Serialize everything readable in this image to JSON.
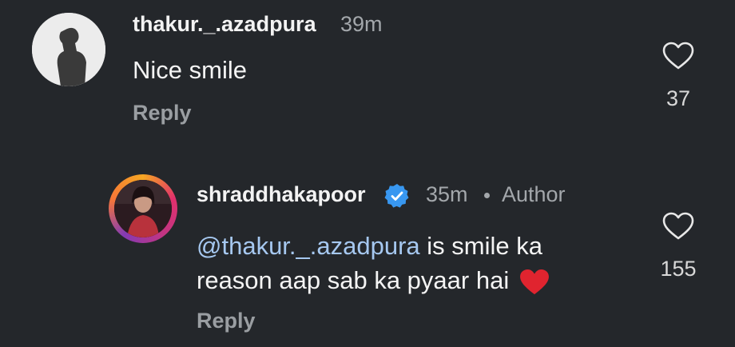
{
  "comments": [
    {
      "username": "thakur._.azadpura",
      "time": "39m",
      "text": "Nice smile",
      "reply_label": "Reply",
      "like_count": "37",
      "avatar_icon": "user-avatar-icon"
    },
    {
      "username": "shraddhakapoor",
      "time": "35m",
      "author_label": "Author",
      "mention": "@thakur._.azadpura",
      "text_line1": " is smile ka",
      "text_line2": "reason aap sab ka pyaar hai",
      "reply_label": "Reply",
      "like_count": "155",
      "verified_icon": "verified-badge-icon",
      "avatar_icon": "user-avatar-icon"
    }
  ],
  "colors": {
    "background": "#24272b",
    "mention": "#a6c8f0",
    "verified": "#3897f0",
    "heart_emoji": "#e0242f"
  }
}
